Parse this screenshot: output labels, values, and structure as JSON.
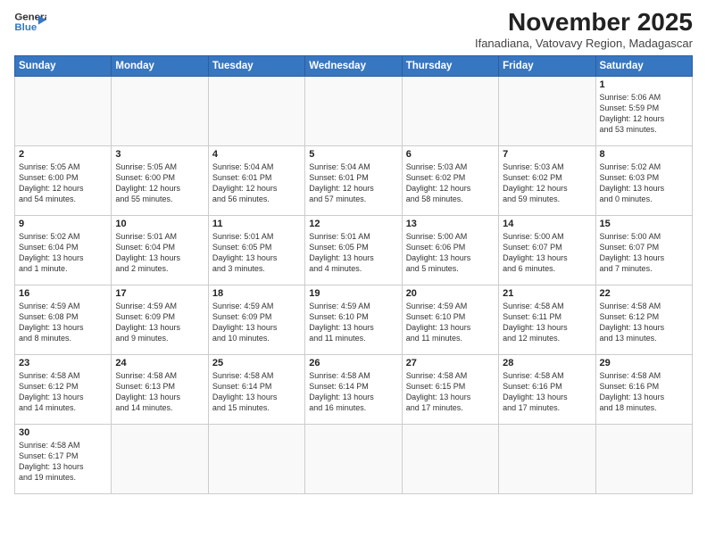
{
  "header": {
    "logo_line1": "General",
    "logo_line2": "Blue",
    "month_title": "November 2025",
    "location": "Ifanadiana, Vatovavy Region, Madagascar"
  },
  "weekdays": [
    "Sunday",
    "Monday",
    "Tuesday",
    "Wednesday",
    "Thursday",
    "Friday",
    "Saturday"
  ],
  "weeks": [
    [
      {
        "day": "",
        "info": ""
      },
      {
        "day": "",
        "info": ""
      },
      {
        "day": "",
        "info": ""
      },
      {
        "day": "",
        "info": ""
      },
      {
        "day": "",
        "info": ""
      },
      {
        "day": "",
        "info": ""
      },
      {
        "day": "1",
        "info": "Sunrise: 5:06 AM\nSunset: 5:59 PM\nDaylight: 12 hours\nand 53 minutes."
      }
    ],
    [
      {
        "day": "2",
        "info": "Sunrise: 5:05 AM\nSunset: 6:00 PM\nDaylight: 12 hours\nand 54 minutes."
      },
      {
        "day": "3",
        "info": "Sunrise: 5:05 AM\nSunset: 6:00 PM\nDaylight: 12 hours\nand 55 minutes."
      },
      {
        "day": "4",
        "info": "Sunrise: 5:04 AM\nSunset: 6:01 PM\nDaylight: 12 hours\nand 56 minutes."
      },
      {
        "day": "5",
        "info": "Sunrise: 5:04 AM\nSunset: 6:01 PM\nDaylight: 12 hours\nand 57 minutes."
      },
      {
        "day": "6",
        "info": "Sunrise: 5:03 AM\nSunset: 6:02 PM\nDaylight: 12 hours\nand 58 minutes."
      },
      {
        "day": "7",
        "info": "Sunrise: 5:03 AM\nSunset: 6:02 PM\nDaylight: 12 hours\nand 59 minutes."
      },
      {
        "day": "8",
        "info": "Sunrise: 5:02 AM\nSunset: 6:03 PM\nDaylight: 13 hours\nand 0 minutes."
      }
    ],
    [
      {
        "day": "9",
        "info": "Sunrise: 5:02 AM\nSunset: 6:04 PM\nDaylight: 13 hours\nand 1 minute."
      },
      {
        "day": "10",
        "info": "Sunrise: 5:01 AM\nSunset: 6:04 PM\nDaylight: 13 hours\nand 2 minutes."
      },
      {
        "day": "11",
        "info": "Sunrise: 5:01 AM\nSunset: 6:05 PM\nDaylight: 13 hours\nand 3 minutes."
      },
      {
        "day": "12",
        "info": "Sunrise: 5:01 AM\nSunset: 6:05 PM\nDaylight: 13 hours\nand 4 minutes."
      },
      {
        "day": "13",
        "info": "Sunrise: 5:00 AM\nSunset: 6:06 PM\nDaylight: 13 hours\nand 5 minutes."
      },
      {
        "day": "14",
        "info": "Sunrise: 5:00 AM\nSunset: 6:07 PM\nDaylight: 13 hours\nand 6 minutes."
      },
      {
        "day": "15",
        "info": "Sunrise: 5:00 AM\nSunset: 6:07 PM\nDaylight: 13 hours\nand 7 minutes."
      }
    ],
    [
      {
        "day": "16",
        "info": "Sunrise: 4:59 AM\nSunset: 6:08 PM\nDaylight: 13 hours\nand 8 minutes."
      },
      {
        "day": "17",
        "info": "Sunrise: 4:59 AM\nSunset: 6:09 PM\nDaylight: 13 hours\nand 9 minutes."
      },
      {
        "day": "18",
        "info": "Sunrise: 4:59 AM\nSunset: 6:09 PM\nDaylight: 13 hours\nand 10 minutes."
      },
      {
        "day": "19",
        "info": "Sunrise: 4:59 AM\nSunset: 6:10 PM\nDaylight: 13 hours\nand 11 minutes."
      },
      {
        "day": "20",
        "info": "Sunrise: 4:59 AM\nSunset: 6:10 PM\nDaylight: 13 hours\nand 11 minutes."
      },
      {
        "day": "21",
        "info": "Sunrise: 4:58 AM\nSunset: 6:11 PM\nDaylight: 13 hours\nand 12 minutes."
      },
      {
        "day": "22",
        "info": "Sunrise: 4:58 AM\nSunset: 6:12 PM\nDaylight: 13 hours\nand 13 minutes."
      }
    ],
    [
      {
        "day": "23",
        "info": "Sunrise: 4:58 AM\nSunset: 6:12 PM\nDaylight: 13 hours\nand 14 minutes."
      },
      {
        "day": "24",
        "info": "Sunrise: 4:58 AM\nSunset: 6:13 PM\nDaylight: 13 hours\nand 14 minutes."
      },
      {
        "day": "25",
        "info": "Sunrise: 4:58 AM\nSunset: 6:14 PM\nDaylight: 13 hours\nand 15 minutes."
      },
      {
        "day": "26",
        "info": "Sunrise: 4:58 AM\nSunset: 6:14 PM\nDaylight: 13 hours\nand 16 minutes."
      },
      {
        "day": "27",
        "info": "Sunrise: 4:58 AM\nSunset: 6:15 PM\nDaylight: 13 hours\nand 17 minutes."
      },
      {
        "day": "28",
        "info": "Sunrise: 4:58 AM\nSunset: 6:16 PM\nDaylight: 13 hours\nand 17 minutes."
      },
      {
        "day": "29",
        "info": "Sunrise: 4:58 AM\nSunset: 6:16 PM\nDaylight: 13 hours\nand 18 minutes."
      }
    ],
    [
      {
        "day": "30",
        "info": "Sunrise: 4:58 AM\nSunset: 6:17 PM\nDaylight: 13 hours\nand 19 minutes."
      },
      {
        "day": "",
        "info": ""
      },
      {
        "day": "",
        "info": ""
      },
      {
        "day": "",
        "info": ""
      },
      {
        "day": "",
        "info": ""
      },
      {
        "day": "",
        "info": ""
      },
      {
        "day": "",
        "info": ""
      }
    ]
  ]
}
